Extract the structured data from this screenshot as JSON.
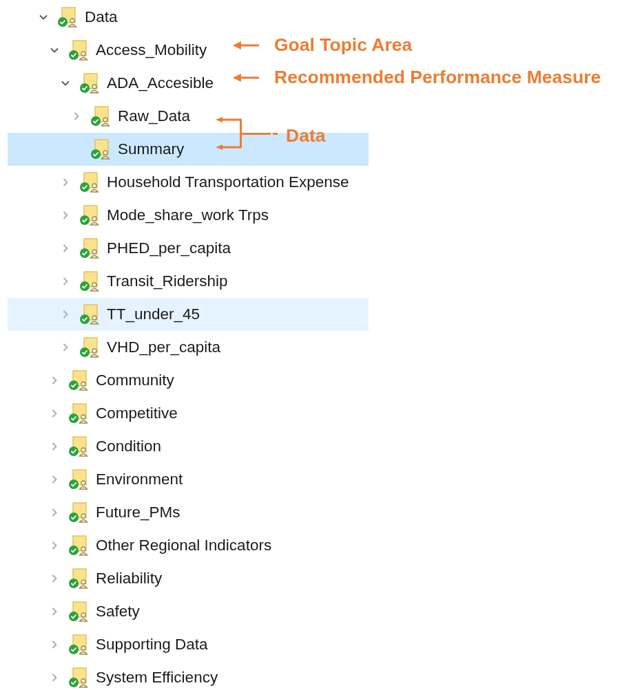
{
  "tree": [
    {
      "label": "Data",
      "expandable": true,
      "expanded": true,
      "selected": false,
      "hovered": false,
      "children": [
        {
          "label": "Access_Mobility",
          "expandable": true,
          "expanded": true,
          "selected": false,
          "hovered": false,
          "children": [
            {
              "label": "ADA_Accesible",
              "expandable": true,
              "expanded": true,
              "selected": false,
              "hovered": false,
              "children": [
                {
                  "label": "Raw_Data",
                  "expandable": true,
                  "expanded": false,
                  "selected": false,
                  "hovered": false
                },
                {
                  "label": "Summary",
                  "expandable": false,
                  "expanded": false,
                  "selected": true,
                  "hovered": false
                }
              ]
            },
            {
              "label": "Household Transportation Expense",
              "expandable": true,
              "expanded": false,
              "selected": false,
              "hovered": false
            },
            {
              "label": "Mode_share_work Trps",
              "expandable": true,
              "expanded": false,
              "selected": false,
              "hovered": false
            },
            {
              "label": "PHED_per_capita",
              "expandable": true,
              "expanded": false,
              "selected": false,
              "hovered": false
            },
            {
              "label": "Transit_Ridership",
              "expandable": true,
              "expanded": false,
              "selected": false,
              "hovered": false
            },
            {
              "label": "TT_under_45",
              "expandable": true,
              "expanded": false,
              "selected": false,
              "hovered": true
            },
            {
              "label": "VHD_per_capita",
              "expandable": true,
              "expanded": false,
              "selected": false,
              "hovered": false
            }
          ]
        },
        {
          "label": "Community",
          "expandable": true,
          "expanded": false,
          "selected": false,
          "hovered": false
        },
        {
          "label": "Competitive",
          "expandable": true,
          "expanded": false,
          "selected": false,
          "hovered": false
        },
        {
          "label": "Condition",
          "expandable": true,
          "expanded": false,
          "selected": false,
          "hovered": false
        },
        {
          "label": "Environment",
          "expandable": true,
          "expanded": false,
          "selected": false,
          "hovered": false
        },
        {
          "label": "Future_PMs",
          "expandable": true,
          "expanded": false,
          "selected": false,
          "hovered": false
        },
        {
          "label": "Other Regional Indicators",
          "expandable": true,
          "expanded": false,
          "selected": false,
          "hovered": false
        },
        {
          "label": "Reliability",
          "expandable": true,
          "expanded": false,
          "selected": false,
          "hovered": false
        },
        {
          "label": "Safety",
          "expandable": true,
          "expanded": false,
          "selected": false,
          "hovered": false
        },
        {
          "label": "Supporting Data",
          "expandable": true,
          "expanded": false,
          "selected": false,
          "hovered": false
        },
        {
          "label": "System Efficiency",
          "expandable": true,
          "expanded": false,
          "selected": false,
          "hovered": false
        }
      ]
    }
  ],
  "annotations": [
    {
      "kind": "arrow",
      "label": "Goal Topic Area"
    },
    {
      "kind": "arrow",
      "label": "Recommended Performance Measure"
    },
    {
      "kind": "bracket",
      "label": "Data"
    }
  ]
}
